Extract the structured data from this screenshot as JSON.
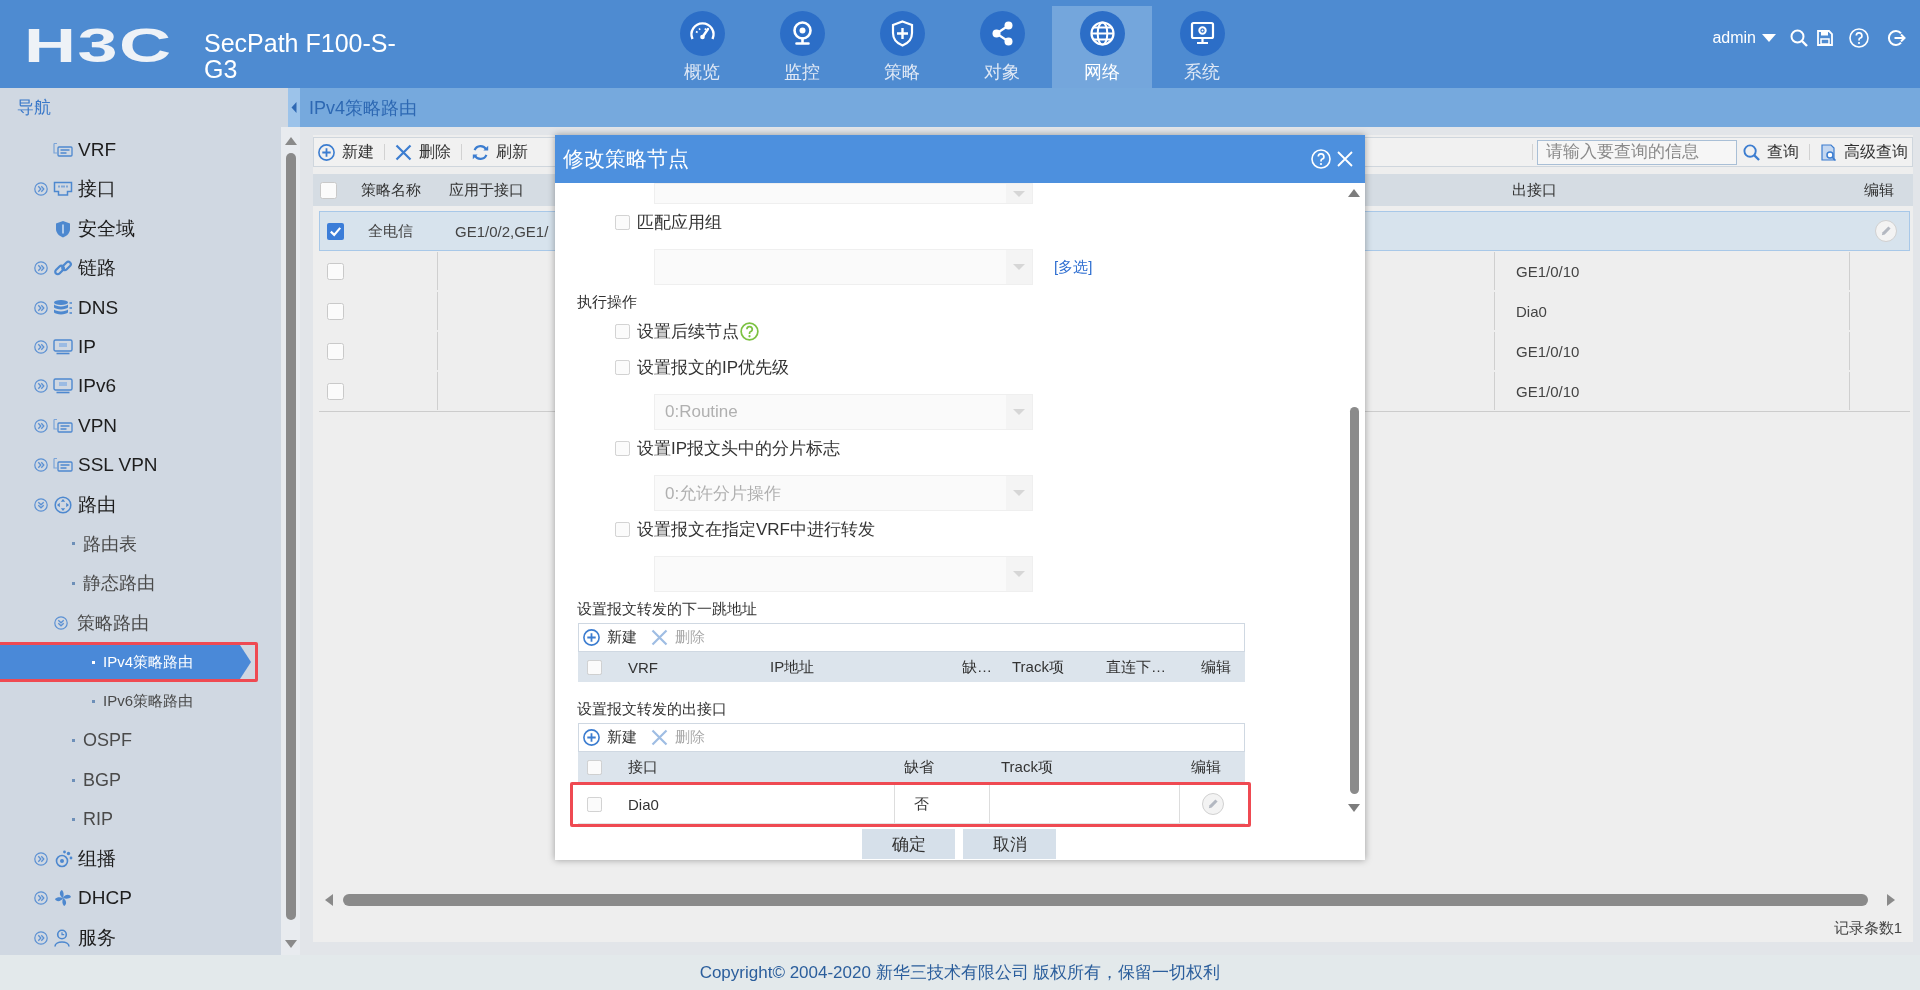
{
  "header": {
    "logo": "H3C",
    "product": "SecPath F100-S-G3",
    "nav": [
      {
        "label": "概览",
        "selected": false
      },
      {
        "label": "监控",
        "selected": false
      },
      {
        "label": "策略",
        "selected": false
      },
      {
        "label": "对象",
        "selected": false
      },
      {
        "label": "网络",
        "selected": true
      },
      {
        "label": "系统",
        "selected": false
      }
    ],
    "user": "admin"
  },
  "sidebar": {
    "title": "导航",
    "items": [
      {
        "label": "VRF",
        "selected": false
      },
      {
        "label": "接口",
        "selected": false,
        "expanded": false
      },
      {
        "label": "安全域",
        "selected": false
      },
      {
        "label": "链路",
        "selected": false,
        "expanded": false
      },
      {
        "label": "DNS",
        "selected": false,
        "expanded": false
      },
      {
        "label": "IP",
        "selected": false,
        "expanded": false
      },
      {
        "label": "IPv6",
        "selected": false,
        "expanded": false
      },
      {
        "label": "VPN",
        "selected": false,
        "expanded": false
      },
      {
        "label": "SSL VPN",
        "selected": false,
        "expanded": false
      },
      {
        "label": "路由",
        "selected": false,
        "expanded": true,
        "children": [
          {
            "label": "路由表",
            "selected": false
          },
          {
            "label": "静态路由",
            "selected": false
          },
          {
            "label": "策略路由",
            "selected": false,
            "expanded": true,
            "children": [
              {
                "label": "IPv4策略路由",
                "selected": true,
                "highlighted": true
              },
              {
                "label": "IPv6策略路由",
                "selected": false,
                "highlighted": false
              }
            ]
          },
          {
            "label": "OSPF",
            "selected": false
          },
          {
            "label": "BGP",
            "selected": false
          },
          {
            "label": "RIP",
            "selected": false
          }
        ]
      },
      {
        "label": "组播",
        "selected": false,
        "expanded": false
      },
      {
        "label": "DHCP",
        "selected": false,
        "expanded": false
      },
      {
        "label": "服务",
        "selected": false,
        "expanded": false
      }
    ]
  },
  "breadcrumb": "IPv4策略路由",
  "toolbar": {
    "actions": [
      "新建",
      "删除",
      "刷新"
    ],
    "search": {
      "placeholder": "请输入要查询的信息"
    },
    "search_button": "查询",
    "advanced_button": "高级查询"
  },
  "table": {
    "all_checked": false,
    "columns": [
      "策略名称",
      "应用于接口",
      "出接口",
      "编辑"
    ],
    "rows": [
      {
        "kind": "policy",
        "selected": true,
        "checked": true,
        "name": "全电信",
        "interface": "GE1/0/2,GE1/"
      },
      {
        "kind": "node",
        "selected": false,
        "checked": false,
        "out_interface": "GE1/0/10"
      },
      {
        "kind": "node",
        "selected": false,
        "checked": false,
        "out_interface": "Dia0"
      },
      {
        "kind": "node",
        "selected": false,
        "checked": false,
        "out_interface": "GE1/0/10"
      },
      {
        "kind": "node",
        "selected": false,
        "checked": false,
        "out_interface": "GE1/0/10"
      }
    ],
    "record_count": "记录条数1"
  },
  "dialog": {
    "title": "修改策略节点",
    "form": [
      {
        "kind": "select",
        "disabled": true
      },
      {
        "kind": "checkbox",
        "label": "匹配应用组",
        "checked": false
      },
      {
        "kind": "select",
        "disabled": true,
        "link": "[多选]"
      },
      {
        "kind": "heading",
        "label": "执行操作"
      },
      {
        "kind": "checkbox",
        "label": "设置后续节点",
        "checked": false,
        "help": true
      },
      {
        "kind": "checkbox",
        "label": "设置报文的IP优先级",
        "checked": false
      },
      {
        "kind": "select",
        "disabled": true,
        "value": "0:Routine"
      },
      {
        "kind": "checkbox",
        "label": "设置IP报文头中的分片标志",
        "checked": false
      },
      {
        "kind": "select",
        "disabled": true,
        "value": "0:允许分片操作"
      },
      {
        "kind": "checkbox",
        "label": "设置报文在指定VRF中进行转发",
        "checked": false
      },
      {
        "kind": "select",
        "disabled": true
      },
      {
        "kind": "heading",
        "label": "设置报文转发的下一跳地址"
      },
      {
        "kind": "table",
        "all_checked": false,
        "actions": [
          {
            "label": "新建",
            "disabled": false
          },
          {
            "label": "删除",
            "disabled": true
          }
        ],
        "columns": [
          "VRF",
          "IP地址",
          "缺…",
          "Track项",
          "直连下…",
          "编辑"
        ]
      },
      {
        "kind": "heading",
        "label": "设置报文转发的出接口"
      },
      {
        "kind": "table",
        "all_checked": false,
        "actions": [
          {
            "label": "新建",
            "disabled": false
          },
          {
            "label": "删除",
            "disabled": true
          }
        ],
        "columns": [
          "接口",
          "缺省",
          "Track项",
          "编辑"
        ],
        "rows": [
          {
            "checked": false,
            "highlighted": true,
            "interface": "Dia0",
            "default": "否"
          }
        ]
      }
    ],
    "buttons": [
      "确定",
      "取消"
    ]
  },
  "footer": "Copyright© 2004-2020 新华三技术有限公司 版权所有，保留一切权利"
}
